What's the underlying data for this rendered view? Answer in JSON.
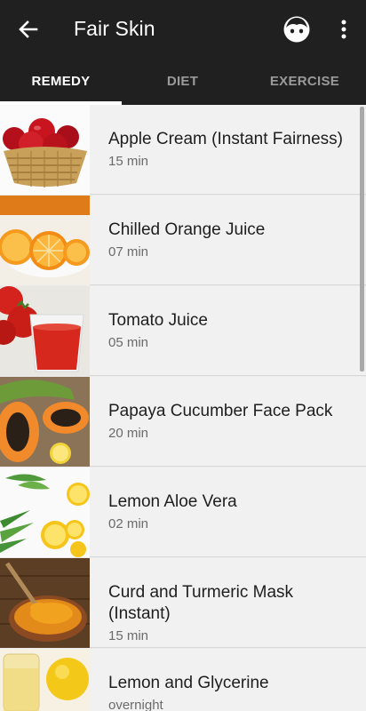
{
  "appbar": {
    "title": "Fair Skin"
  },
  "tabs": [
    {
      "label": "REMEDY",
      "active": true
    },
    {
      "label": "DIET",
      "active": false
    },
    {
      "label": "EXERCISE",
      "active": false
    }
  ],
  "remedies": [
    {
      "title": "Apple Cream (Instant Fairness)",
      "time": "15 min",
      "image": "apples-basket"
    },
    {
      "title": "Chilled Orange Juice",
      "time": "07 min",
      "image": "orange-slices"
    },
    {
      "title": "Tomato Juice",
      "time": "05 min",
      "image": "tomato-juice-glass"
    },
    {
      "title": "Papaya Cucumber Face Pack",
      "time": "20 min",
      "image": "papaya-halves"
    },
    {
      "title": "Lemon Aloe Vera",
      "time": "02 min",
      "image": "lemon-aloe"
    },
    {
      "title": "Curd and Turmeric Mask (Instant)",
      "time": "15 min",
      "image": "turmeric-spoon"
    },
    {
      "title": "Lemon and Glycerine",
      "time": "overnight",
      "image": "lemon-glycerine"
    }
  ],
  "colors": {
    "appbar": "#202020",
    "list_bg": "#f1f1f1",
    "tab_inactive": "#9a9a9a"
  },
  "icons": {
    "back": "arrow-left-icon",
    "profile": "face-icon",
    "more": "more-vert-icon"
  }
}
